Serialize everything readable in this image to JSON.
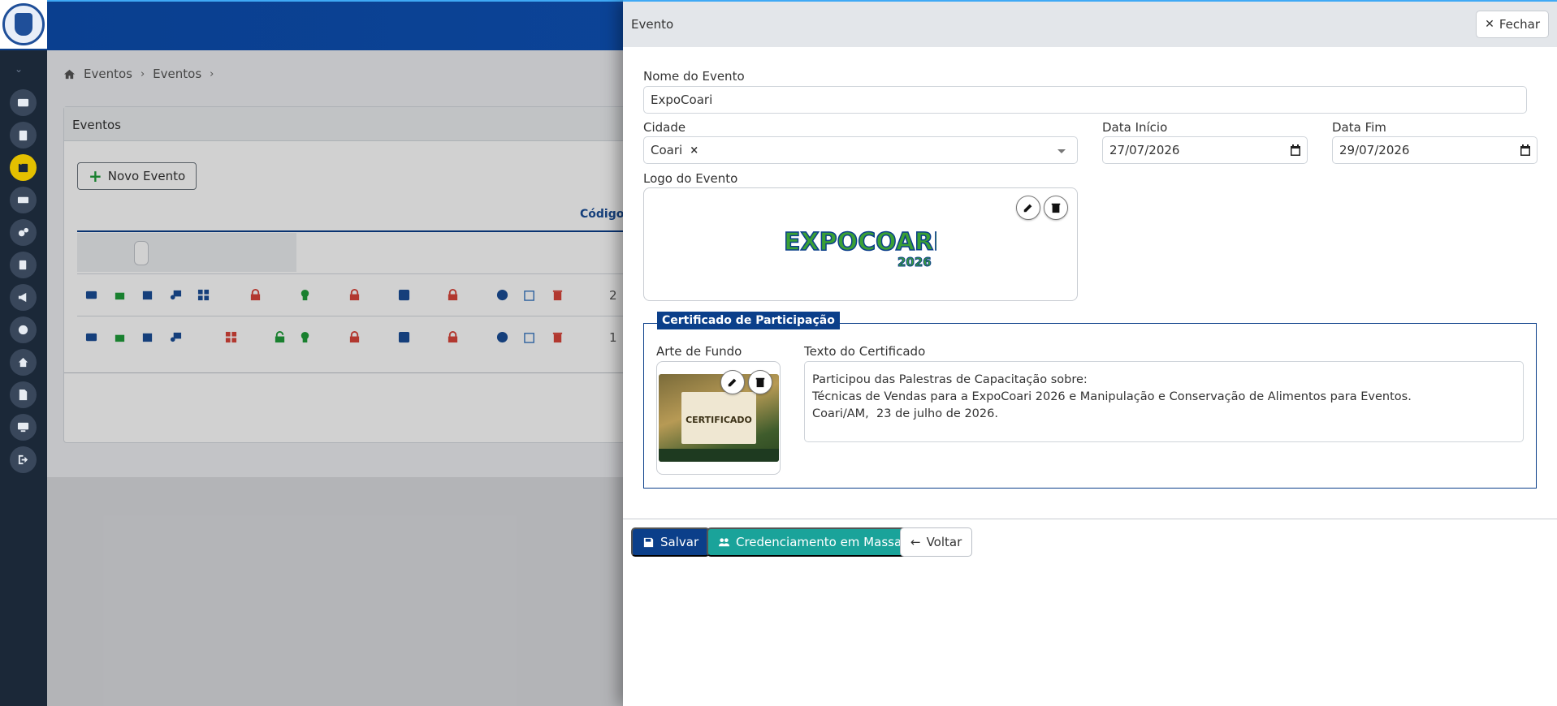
{
  "background": {
    "breadcrumb": [
      "Eventos",
      "Eventos"
    ],
    "card_title": "Eventos",
    "new_event_label": "Novo Evento",
    "column_code": "Código",
    "rows": [
      {
        "code": "2"
      },
      {
        "code": "1"
      }
    ]
  },
  "drawer": {
    "title": "Evento",
    "close_label": "Fechar",
    "event_name_label": "Nome do Evento",
    "event_name_value": "ExpoCoari",
    "city_label": "Cidade",
    "city_value": "Coari",
    "start_label": "Data Início",
    "start_value": "27/07/2026",
    "end_label": "Data Fim",
    "end_value": "29/07/2026",
    "logo_label": "Logo do Evento",
    "logo_text_main": "EXPOCOARI",
    "logo_text_year": "2026",
    "certificate": {
      "legend": "Certificado de Participação",
      "background_label": "Arte de Fundo",
      "background_word": "CERTIFICADO",
      "text_label": "Texto do Certificado",
      "text_lines": [
        "Participou das Palestras de Capacitação sobre:",
        "Técnicas de Vendas para a ExpoCoari 2026 e Manipulação e Conservação de Alimentos para Eventos.",
        "Coari/AM,  23 de julho de 2026."
      ]
    },
    "buttons": {
      "save": "Salvar",
      "mass": "Credenciamento em Massa",
      "back": "Voltar"
    }
  },
  "colors": {
    "primary": "#0b3f8a",
    "teal": "#1aa39a",
    "rail": "#1b2838",
    "active": "#e4c000",
    "red": "#d9453a",
    "green": "#1f9d3a"
  }
}
